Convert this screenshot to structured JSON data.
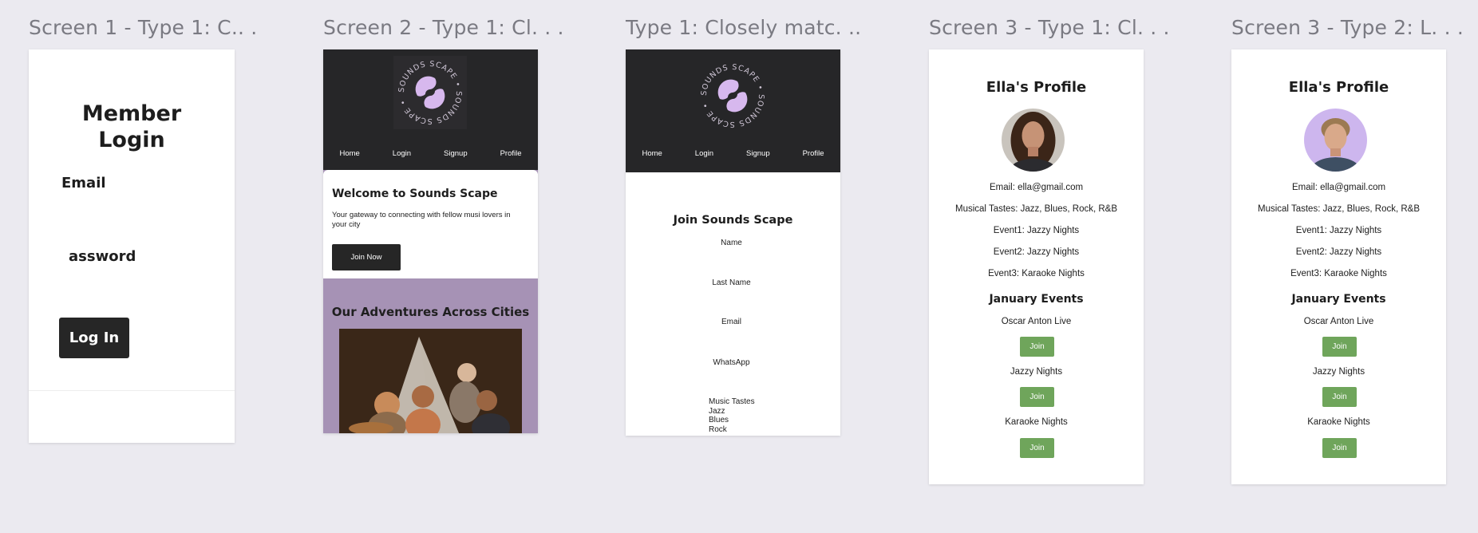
{
  "canvas": {
    "background": "#ebeaf0"
  },
  "frames": [
    {
      "title": "Screen 1 - Type 1: C.. ."
    },
    {
      "title": "Screen 2 - Type 1: Cl. . ."
    },
    {
      "title": "Type 1: Closely matc. .."
    },
    {
      "title": "Screen 3 - Type 1: Cl. . ."
    },
    {
      "title": "Screen 3 - Type 2: L. . ."
    }
  ],
  "login": {
    "title_line1": "Member",
    "title_line2": "Login",
    "email_label": "Email",
    "password_label": "assword",
    "button": "Log In"
  },
  "logo": {
    "ring_text": "SOUNDS SCAPE • SOUNDS SCAPE •",
    "accent": "#d7b8ee"
  },
  "nav": [
    "Home",
    "Login",
    "Signup",
    "Profile"
  ],
  "home": {
    "heading": "Welcome to Sounds Scape",
    "tagline": "Your gateway to connecting with fellow musi lovers in your city",
    "cta": "Join Now",
    "section_title": "Our Adventures Across Cities",
    "section_bg": "#a692b5"
  },
  "signup": {
    "heading": "Join Sounds Scape",
    "fields": [
      "Name",
      "Last Name",
      "Email",
      "WhatsApp"
    ],
    "tastes_label": "Music Tastes",
    "tastes": [
      "Jazz",
      "Blues",
      "Rock"
    ]
  },
  "profiles": [
    {
      "title": "Ella's Profile",
      "email": "Email: ella@gmail.com",
      "tastes": "Musical Tastes: Jazz, Blues, Rock, R&B",
      "events": [
        "Event1: Jazzy Nights",
        "Event2: Jazzy Nights",
        "Event3: Karaoke Nights"
      ],
      "section": "January Events",
      "january": [
        "Oscar Anton Live",
        "Jazzy Nights",
        "Karaoke Nights"
      ],
      "join_label": "Join"
    },
    {
      "title": "Ella's Profile",
      "email": "Email: ella@gmail.com",
      "tastes": "Musical Tastes: Jazz, Blues, Rock, R&B",
      "events": [
        "Event1: Jazzy Nights",
        "Event2: Jazzy Nights",
        "Event3: Karaoke Nights"
      ],
      "section": "January Events",
      "january": [
        "Oscar Anton Live",
        "Jazzy Nights",
        "Karaoke Nights"
      ],
      "join_label": "Join"
    }
  ],
  "colors": {
    "dark": "#262628",
    "join_green": "#6fa55b"
  }
}
